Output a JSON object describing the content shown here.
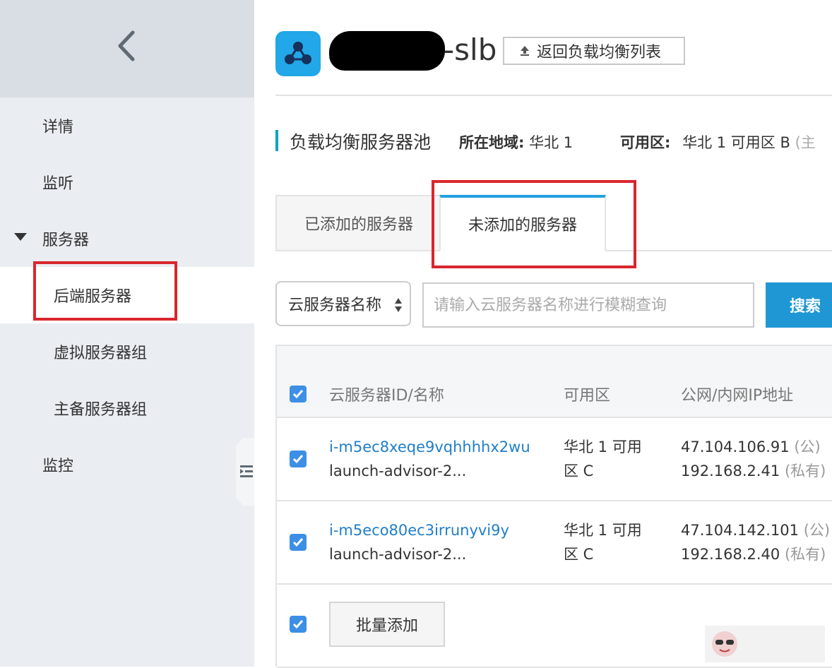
{
  "sidebar": {
    "items": [
      {
        "label": "详情"
      },
      {
        "label": "监听"
      },
      {
        "label": "服务器"
      },
      {
        "label": "后端服务器"
      },
      {
        "label": "虚拟服务器组"
      },
      {
        "label": "主备服务器组"
      },
      {
        "label": "监控"
      }
    ]
  },
  "header": {
    "title_suffix": "-slb",
    "back_button": "返回负载均衡列表"
  },
  "pool": {
    "title": "负载均衡服务器池",
    "region_label": "所在地域:",
    "region_value": "华北 1",
    "zone_label": "可用区:",
    "zone_value": "华北 1 可用区 B",
    "zone_extra": "(主"
  },
  "tabs": [
    {
      "label": "已添加的服务器"
    },
    {
      "label": "未添加的服务器"
    }
  ],
  "search": {
    "field_select": "云服务器名称",
    "placeholder": "请输入云服务器名称进行模糊查询",
    "button": "搜索"
  },
  "table": {
    "headers": [
      "云服务器ID/名称",
      "可用区",
      "公网/内网IP地址"
    ],
    "rows": [
      {
        "id": "i-m5ec8xeqe9vqhhhhx2wu",
        "name": "launch-advisor-2...",
        "zone_line1": "华北 1 可用",
        "zone_line2": "区 C",
        "public_ip": "47.104.106.91",
        "public_tag": "(公)",
        "private_ip": "192.168.2.41",
        "private_tag": "(私有)"
      },
      {
        "id": "i-m5eco80ec3irrunyvi9y",
        "name": "launch-advisor-2...",
        "zone_line1": "华北 1 可用",
        "zone_line2": "区 C",
        "public_ip": "47.104.142.101",
        "public_tag": "(公)",
        "private_ip": "192.168.2.40",
        "private_tag": "(私有)"
      }
    ],
    "batch_button": "批量添加"
  },
  "colors": {
    "accent": "#22a2dd",
    "primary_button": "#1f97d4",
    "highlight_box": "#d9262c",
    "checkbox": "#3c8fe5",
    "link": "#1f7ec8"
  }
}
